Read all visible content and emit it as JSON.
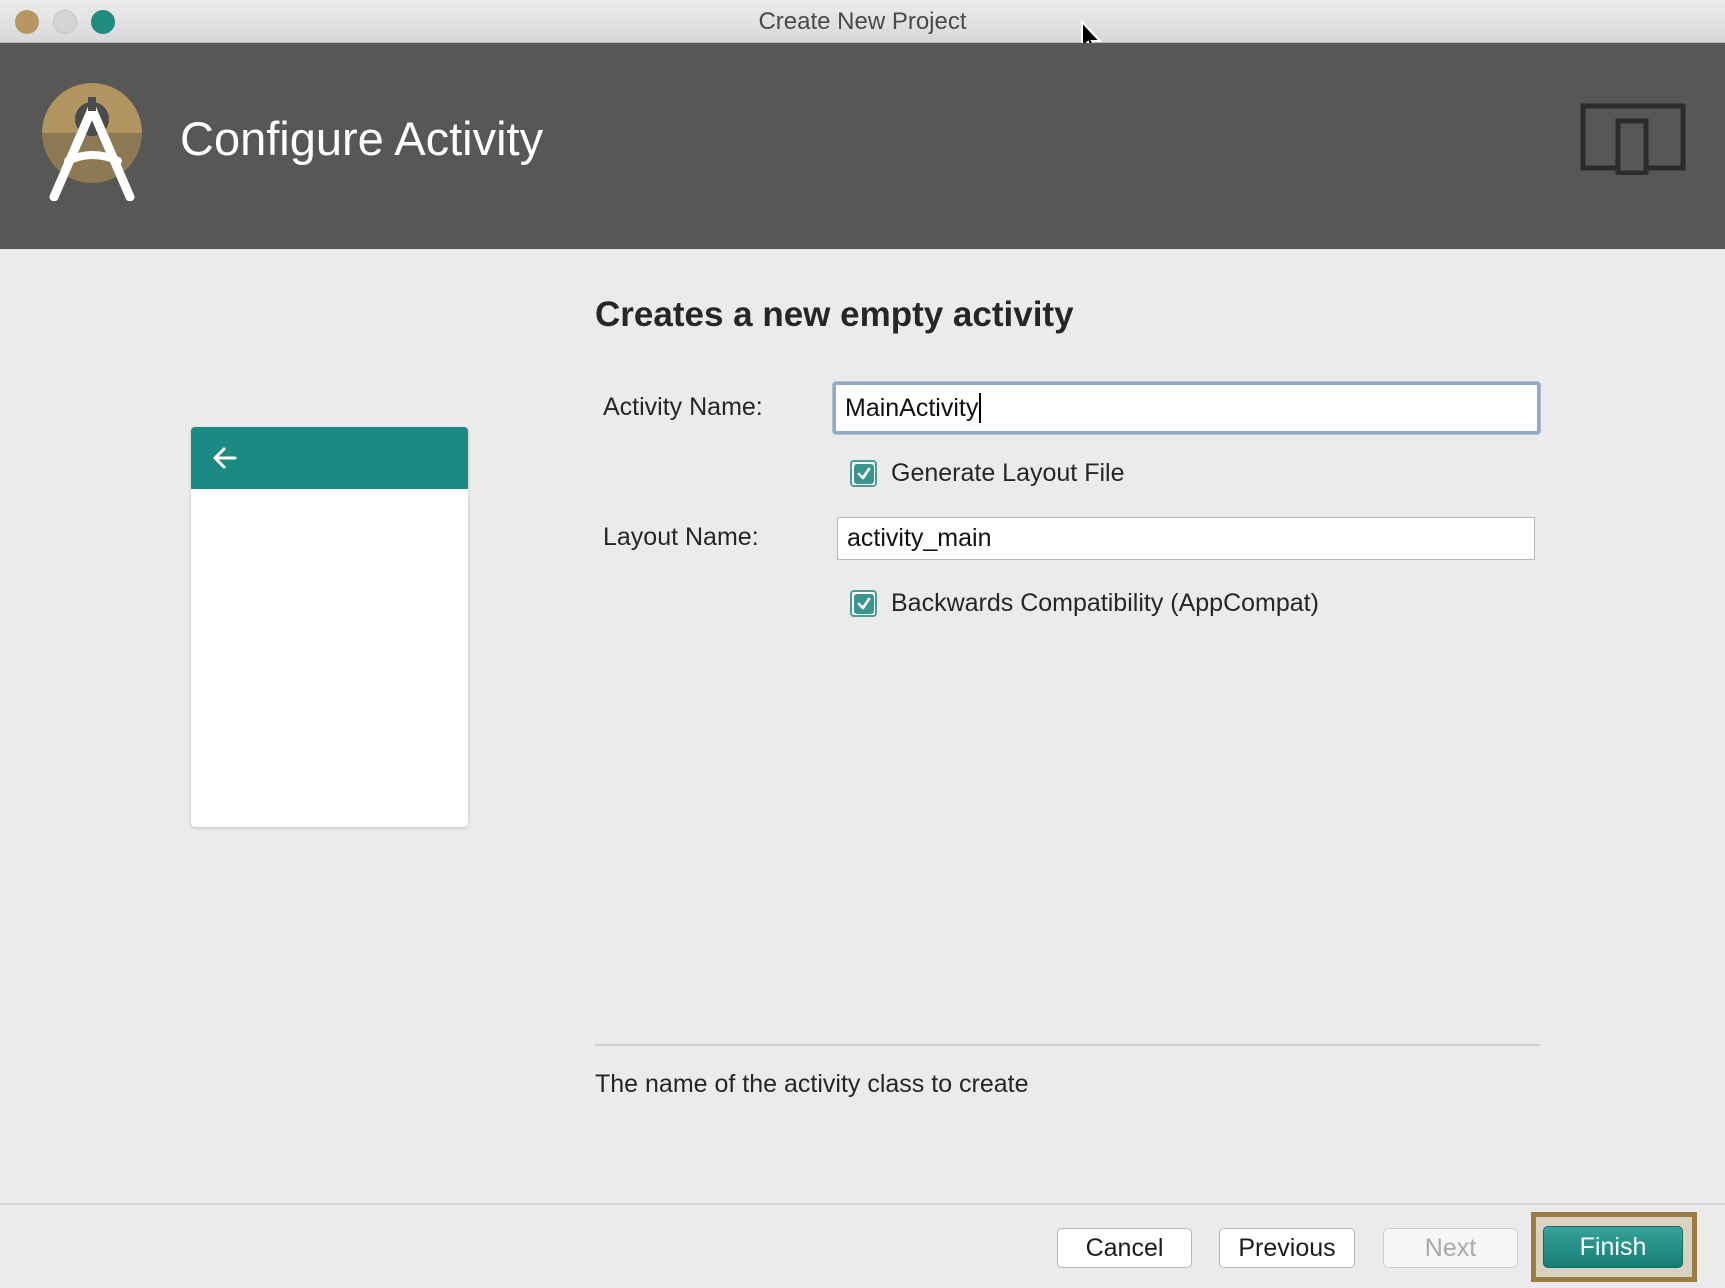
{
  "window": {
    "title": "Create New Project"
  },
  "header": {
    "title": "Configure Activity",
    "logo_icon": "android-studio-logo-icon",
    "device_icon": "phone-tablet-device-icon"
  },
  "preview": {
    "back_icon": "arrow-back-icon",
    "toolbar_color": "#1c8a82"
  },
  "form": {
    "heading": "Creates a new empty activity",
    "activity_name_label": "Activity Name:",
    "activity_name_value": "MainActivity",
    "generate_layout_label": "Generate Layout File",
    "generate_layout_checked": true,
    "layout_name_label": "Layout Name:",
    "layout_name_value": "activity_main",
    "backwards_compat_label": "Backwards Compatibility (AppCompat)",
    "backwards_compat_checked": true,
    "hint": "The name of the activity class to create"
  },
  "buttons": {
    "cancel": "Cancel",
    "previous": "Previous",
    "next": "Next",
    "finish": "Finish"
  },
  "colors": {
    "accent": "#1c8a82",
    "header_bg": "#575757",
    "highlight_frame": "#9c7b44"
  }
}
